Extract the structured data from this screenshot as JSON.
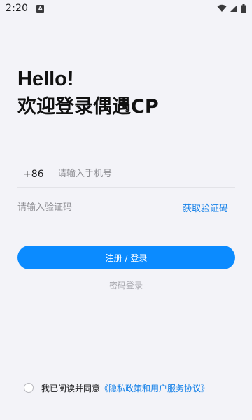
{
  "status_bar": {
    "time": "2:20",
    "notification_letter": "A"
  },
  "greeting": {
    "line1": "Hello!",
    "line2": "欢迎登录偶遇CP"
  },
  "phone_field": {
    "country_code": "+86",
    "placeholder": "请输入手机号",
    "value": ""
  },
  "code_field": {
    "placeholder": "请输入验证码",
    "value": "",
    "get_code_label": "获取验证码"
  },
  "login_button_label": "注册 / 登录",
  "password_login_label": "密码登录",
  "agreement": {
    "checked": false,
    "text": "我已阅读并同意",
    "link_label": "《隐私政策和用户服务协议》"
  },
  "colors": {
    "accent": "#0b8bff",
    "link": "#1480e8",
    "background": "#f3f3f8"
  }
}
